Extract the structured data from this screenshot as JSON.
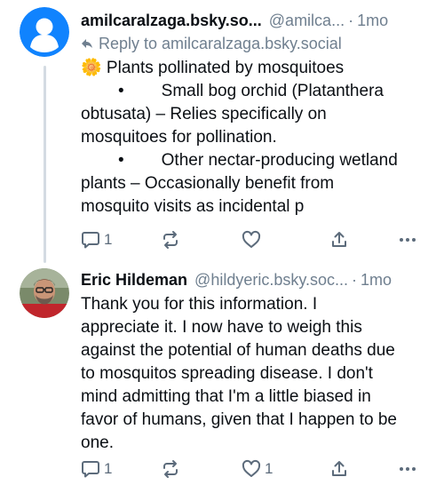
{
  "posts": [
    {
      "author_name": "amilcaralzaga.bsky.so...",
      "handle": "@amilca...",
      "separator": "·",
      "time": "1mo",
      "reply_to": "Reply to amilcaralzaga.bsky.social",
      "lines": [
        "🌼 Plants pollinated by mosquitoes",
        "\t•\tSmall bog orchid (Platanthera",
        "obtusata) – Relies specifically on",
        "mosquitoes for pollination.",
        "\t•\tOther nectar-producing wetland",
        "plants – Occasionally benefit from",
        "mosquito visits as incidental p"
      ],
      "reply_count": "1",
      "repost_count": "",
      "like_count": "",
      "avatar_icon": "default-user-avatar"
    },
    {
      "author_name": "Eric Hildeman",
      "handle": "@hildyeric.bsky.soc...",
      "separator": "·",
      "time": "1mo",
      "lines": [
        "Thank you for this information. I",
        "appreciate it. I now have to weigh this",
        "against the potential of human deaths due",
        "to mosquitos spreading disease. I don't",
        "mind admitting that I'm a little biased in",
        "favor of humans, given that I happen to be",
        "one."
      ],
      "reply_count": "1",
      "repost_count": "",
      "like_count": "1",
      "avatar_icon": "user-photo-avatar"
    }
  ],
  "colors": {
    "accent": "#1083fe",
    "muted": "#6f7f8f",
    "icon": "#5c6b7b",
    "thread_line": "#d4dbe2"
  }
}
